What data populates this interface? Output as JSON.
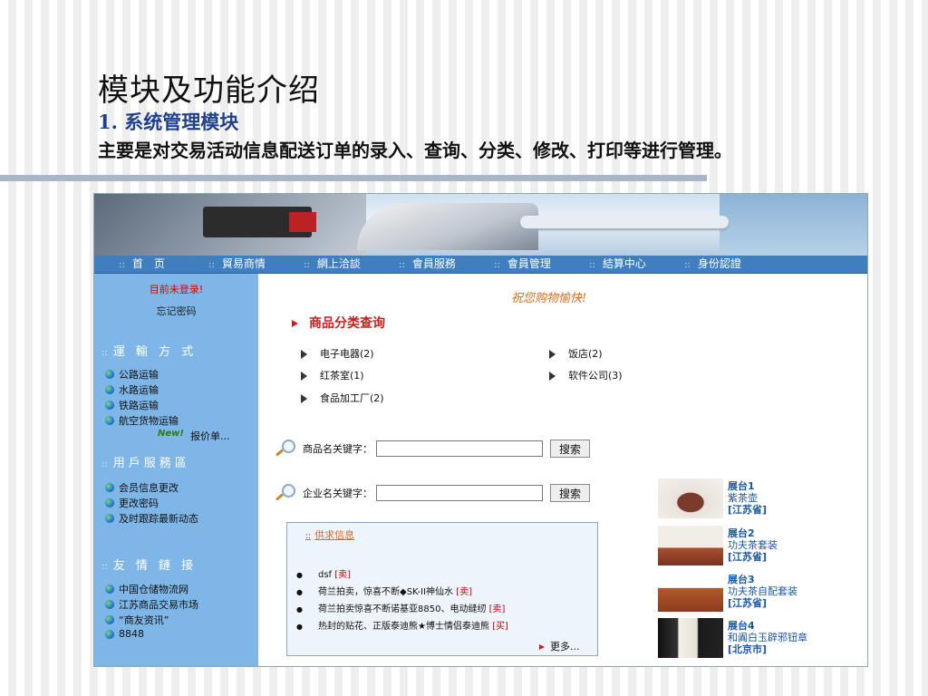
{
  "slide": {
    "title": "模块及功能介绍",
    "subtitle": "1. 系统管理模块",
    "description": "主要是对交易活动信息配送订单的录入、查询、分类、修改、打印等进行管理。"
  },
  "nav": {
    "dots": "::",
    "items": [
      "首　页",
      "貿易商情",
      "網上洽談",
      "會員服務",
      "會員管理",
      "結算中心",
      "身份認證"
    ]
  },
  "sidebar": {
    "login_status": "目前未登录!",
    "forgot_password": "忘记密码",
    "transport": {
      "heading": "運 輸 方 式",
      "items": [
        "公路运输",
        "水路运输",
        "铁路运输",
        "航空货物运输"
      ]
    },
    "new_badge": "New!",
    "quote_link": "报价单...",
    "user_services": {
      "heading": "用戶服務區",
      "items": [
        "会员信息更改",
        "更改密码",
        "及时跟踪最新动态"
      ]
    },
    "links": {
      "heading": "友 情 鏈 接",
      "items": [
        "中国仓储物流网",
        "江苏商品交易市场",
        "“商友资讯”",
        "8848"
      ]
    }
  },
  "main": {
    "welcome": "祝您购物愉快!",
    "category_title": "商品分类查询",
    "categories": [
      "电子电器(2)",
      "饭店(2)",
      "红茶室(1)",
      "软件公司(3)",
      "食品加工厂(2)"
    ],
    "product_search": {
      "label": "商品名关键字：",
      "value": "",
      "button": "搜索"
    },
    "company_search": {
      "label": "企业名关键字：",
      "value": "",
      "button": "搜索"
    },
    "supply": {
      "title": "供求信息",
      "items": [
        {
          "text": "dsf",
          "tag": "[卖]"
        },
        {
          "text": "荷兰拍卖，惊喜不断◆SK-II神仙水",
          "tag": "[卖]"
        },
        {
          "text": "荷兰拍卖惊喜不断诺基亚8850、电动缝纫",
          "tag": "[卖]"
        },
        {
          "text": "热封的贴花、正版泰迪熊★博士情侣泰迪熊",
          "tag": "[买]"
        }
      ],
      "more": "更多..."
    },
    "showcase": [
      {
        "name": "展台1",
        "desc": "紫茶壶",
        "region": "[江苏省]"
      },
      {
        "name": "展台2",
        "desc": "功夫茶套装",
        "region": "[江苏省]"
      },
      {
        "name": "展台3",
        "desc": "功夫茶自配套装",
        "region": "[江苏省]"
      },
      {
        "name": "展台4",
        "desc": "和阗白玉辟邪钮章",
        "region": "[北京市]"
      }
    ]
  }
}
